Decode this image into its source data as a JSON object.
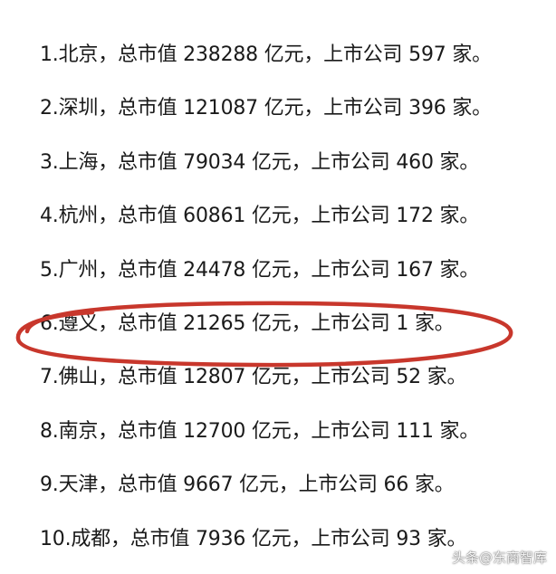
{
  "rankings": [
    "1.北京，总市值 238288 亿元，上市公司 597 家。",
    "2.深圳，总市值 121087 亿元，上市公司 396 家。",
    "3.上海，总市值 79034 亿元，上市公司 460 家。",
    "4.杭州，总市值 60861 亿元，上市公司 172 家。",
    "5.广州，总市值 24478 亿元，上市公司 167 家。",
    "6.遵义，总市值 21265 亿元，上市公司 1 家。",
    "7.佛山，总市值 12807 亿元，上市公司 52 家。",
    "8.南京，总市值 12700 亿元，上市公司 111 家。",
    "9.天津，总市值 9667 亿元，上市公司 66 家。",
    "10.成都，总市值 7936 亿元，上市公司 93 家。"
  ],
  "watermark": "头条@东商智库",
  "highlight_color": "#c8372c",
  "highlighted_row": 6
}
